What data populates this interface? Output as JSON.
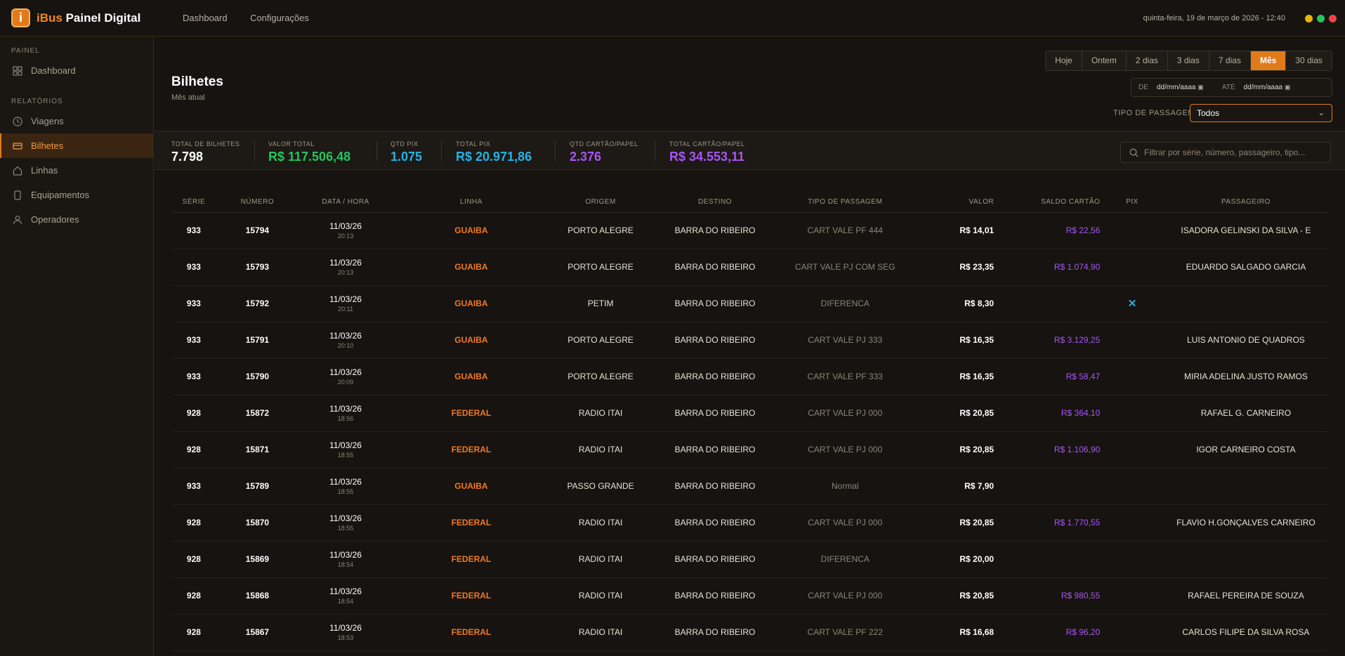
{
  "app": {
    "brand_prefix": "iBus",
    "brand_rest": "Painel Digital",
    "logo_letter": "i"
  },
  "topnav": [
    "Dashboard",
    "Configurações"
  ],
  "datetime": "quinta-feira, 19 de março de 2026 - 12:40",
  "window_dots": [
    "#eab308",
    "#22c55e",
    "#ef4444"
  ],
  "sidebar": {
    "section_painel": "PAINEL",
    "section_relatorios": "RELATÓRIOS",
    "items": [
      {
        "label": "Dashboard",
        "icon": "grid-icon"
      },
      {
        "label": "Viagens",
        "icon": "clock-icon"
      },
      {
        "label": "Bilhetes",
        "icon": "ticket-icon",
        "active": true
      },
      {
        "label": "Linhas",
        "icon": "home-icon"
      },
      {
        "label": "Equipamentos",
        "icon": "device-icon"
      },
      {
        "label": "Operadores",
        "icon": "user-icon"
      }
    ]
  },
  "page": {
    "title": "Bilhetes",
    "subtitle": "Mês atual"
  },
  "ranges": [
    "Hoje",
    "Ontem",
    "2 dias",
    "3 dias",
    "7 dias",
    "Mês",
    "30 dias"
  ],
  "range_active": "Mês",
  "dates": {
    "de_label": "DE",
    "de_placeholder": "dd/mm/aaaa",
    "ate_label": "ATÉ",
    "ate_placeholder": "dd/mm/aaaa"
  },
  "tipo": {
    "label": "TIPO DE PASSAGEM",
    "value": "Todos"
  },
  "stats": [
    {
      "label": "TOTAL DE BILHETES",
      "value": "7.798",
      "color": "#ffffff"
    },
    {
      "label": "VALOR TOTAL",
      "value": "R$ 117.506,48",
      "color": "#22c55e"
    },
    {
      "label": "QTD PIX",
      "value": "1.075",
      "color": "#22b3e6"
    },
    {
      "label": "TOTAL PIX",
      "value": "R$ 20.971,86",
      "color": "#22b3e6"
    },
    {
      "label": "QTD CARTÃO/PAPEL",
      "value": "2.376",
      "color": "#a855f7"
    },
    {
      "label": "TOTAL CARTÃO/PAPEL",
      "value": "R$ 34.553,11",
      "color": "#a855f7"
    }
  ],
  "search": {
    "placeholder": "Filtrar por série, número, passageiro, tipo..."
  },
  "table": {
    "headers": [
      "SÉRIE",
      "NÚMERO",
      "DATA / HORA",
      "LINHA",
      "ORIGEM",
      "DESTINO",
      "TIPO DE PASSAGEM",
      "VALOR",
      "SALDO CARTÃO",
      "PIX",
      "PASSAGEIRO"
    ],
    "rows": [
      {
        "serie": "933",
        "numero": "15794",
        "data": "11/03/26",
        "hora": "20:13",
        "linha": "GUAIBA",
        "origem": "PORTO ALEGRE",
        "destino": "BARRA DO RIBEIRO",
        "tipo": "CART VALE PF 444",
        "valor": "R$ 14,01",
        "saldo": "R$ 22,56",
        "pix": "",
        "passageiro": "ISADORA GELINSKI DA SILVA - E"
      },
      {
        "serie": "933",
        "numero": "15793",
        "data": "11/03/26",
        "hora": "20:13",
        "linha": "GUAIBA",
        "origem": "PORTO ALEGRE",
        "destino": "BARRA DO RIBEIRO",
        "tipo": "CART VALE PJ COM SEG",
        "valor": "R$ 23,35",
        "saldo": "R$ 1.074,90",
        "pix": "",
        "passageiro": "EDUARDO SALGADO GARCIA"
      },
      {
        "serie": "933",
        "numero": "15792",
        "data": "11/03/26",
        "hora": "20:11",
        "linha": "GUAIBA",
        "origem": "PETIM",
        "destino": "BARRA DO RIBEIRO",
        "tipo": "DIFERENCA",
        "valor": "R$ 8,30",
        "saldo": "",
        "pix": "✕",
        "passageiro": ""
      },
      {
        "serie": "933",
        "numero": "15791",
        "data": "11/03/26",
        "hora": "20:10",
        "linha": "GUAIBA",
        "origem": "PORTO ALEGRE",
        "destino": "BARRA DO RIBEIRO",
        "tipo": "CART VALE PJ 333",
        "valor": "R$ 16,35",
        "saldo": "R$ 3.129,25",
        "pix": "",
        "passageiro": "LUIS ANTONIO DE QUADROS"
      },
      {
        "serie": "933",
        "numero": "15790",
        "data": "11/03/26",
        "hora": "20:09",
        "linha": "GUAIBA",
        "origem": "PORTO ALEGRE",
        "destino": "BARRA DO RIBEIRO",
        "tipo": "CART VALE PF 333",
        "valor": "R$ 16,35",
        "saldo": "R$ 58,47",
        "pix": "",
        "passageiro": "MIRIA ADELINA JUSTO RAMOS"
      },
      {
        "serie": "928",
        "numero": "15872",
        "data": "11/03/26",
        "hora": "18:56",
        "linha": "FEDERAL",
        "origem": "RADIO ITAI",
        "destino": "BARRA DO RIBEIRO",
        "tipo": "CART VALE PJ 000",
        "valor": "R$ 20,85",
        "saldo": "R$ 364,10",
        "pix": "",
        "passageiro": "RAFAEL G. CARNEIRO"
      },
      {
        "serie": "928",
        "numero": "15871",
        "data": "11/03/26",
        "hora": "18:55",
        "linha": "FEDERAL",
        "origem": "RADIO ITAI",
        "destino": "BARRA DO RIBEIRO",
        "tipo": "CART VALE PJ 000",
        "valor": "R$ 20,85",
        "saldo": "R$ 1.106,90",
        "pix": "",
        "passageiro": "IGOR CARNEIRO COSTA"
      },
      {
        "serie": "933",
        "numero": "15789",
        "data": "11/03/26",
        "hora": "18:55",
        "linha": "GUAIBA",
        "origem": "PASSO GRANDE",
        "destino": "BARRA DO RIBEIRO",
        "tipo": "Normal",
        "valor": "R$ 7,90",
        "saldo": "",
        "pix": "",
        "passageiro": ""
      },
      {
        "serie": "928",
        "numero": "15870",
        "data": "11/03/26",
        "hora": "18:55",
        "linha": "FEDERAL",
        "origem": "RADIO ITAI",
        "destino": "BARRA DO RIBEIRO",
        "tipo": "CART VALE PJ 000",
        "valor": "R$ 20,85",
        "saldo": "R$ 1.770,55",
        "pix": "",
        "passageiro": "FLAVIO H.GONÇALVES CARNEIRO"
      },
      {
        "serie": "928",
        "numero": "15869",
        "data": "11/03/26",
        "hora": "18:54",
        "linha": "FEDERAL",
        "origem": "RADIO ITAI",
        "destino": "BARRA DO RIBEIRO",
        "tipo": "DIFERENCA",
        "valor": "R$ 20,00",
        "saldo": "",
        "pix": "",
        "passageiro": ""
      },
      {
        "serie": "928",
        "numero": "15868",
        "data": "11/03/26",
        "hora": "18:54",
        "linha": "FEDERAL",
        "origem": "RADIO ITAI",
        "destino": "BARRA DO RIBEIRO",
        "tipo": "CART VALE PJ 000",
        "valor": "R$ 20,85",
        "saldo": "R$ 980,55",
        "pix": "",
        "passageiro": "RAFAEL PEREIRA DE SOUZA"
      },
      {
        "serie": "928",
        "numero": "15867",
        "data": "11/03/26",
        "hora": "18:53",
        "linha": "FEDERAL",
        "origem": "RADIO ITAI",
        "destino": "BARRA DO RIBEIRO",
        "tipo": "CART VALE PF 222",
        "valor": "R$ 16,68",
        "saldo": "R$ 96,20",
        "pix": "",
        "passageiro": "CARLOS FILIPE DA SILVA ROSA"
      }
    ]
  }
}
